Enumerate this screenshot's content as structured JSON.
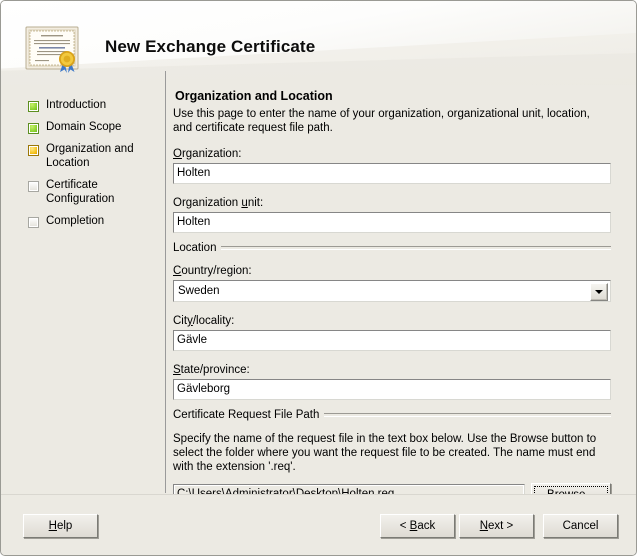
{
  "window": {
    "title": "New Exchange Certificate",
    "icon": "certificate-icon"
  },
  "sidebar": {
    "items": [
      {
        "label": "Introduction",
        "state": "done",
        "icon": "step-complete-icon"
      },
      {
        "label": "Domain Scope",
        "state": "done",
        "icon": "step-complete-icon"
      },
      {
        "label": "Organization and Location",
        "state": "current",
        "icon": "step-current-icon"
      },
      {
        "label": "Certificate Configuration",
        "state": "pending",
        "icon": "step-pending-icon"
      },
      {
        "label": "Completion",
        "state": "pending",
        "icon": "step-pending-icon"
      }
    ]
  },
  "main": {
    "title": "Organization and Location",
    "description": "Use this page to enter the name of your organization, organizational unit, location, and certificate request file path.",
    "fields": {
      "organization": {
        "label_pre": "",
        "label_accel": "O",
        "label_post": "rganization:",
        "value": "Holten"
      },
      "organization_unit": {
        "label_pre": "Organization ",
        "label_accel": "u",
        "label_post": "nit:",
        "value": "Holten"
      },
      "country": {
        "label_pre": "",
        "label_accel": "C",
        "label_post": "ountry/region:",
        "value": "Sweden",
        "icon": "chevron-down-icon"
      },
      "city": {
        "label_pre": "Cit",
        "label_accel": "y",
        "label_post": "/locality:",
        "value": "Gävle"
      },
      "state": {
        "label_pre": "",
        "label_accel": "S",
        "label_post": "tate/province:",
        "value": "Gävleborg"
      },
      "file_path": {
        "value": "C:\\Users\\Administrator\\Desktop\\Holten.req"
      }
    },
    "groups": {
      "location": "Location",
      "certificate_request_file_path": "Certificate Request File Path"
    },
    "file_path_help": "Specify the name of the request file in the text box below. Use the Browse button to select the folder where you want the request file to be created. The name must end with the extension '.req'.",
    "browse_button": {
      "pre": "",
      "accel": "B",
      "post": "rowse..."
    }
  },
  "footer": {
    "help": {
      "pre": "",
      "accel": "H",
      "post": "elp"
    },
    "back": {
      "pre": "< ",
      "accel": "B",
      "post": "ack"
    },
    "next": {
      "pre": "",
      "accel": "N",
      "post": "ext >"
    },
    "cancel": {
      "pre": "Cancel",
      "accel": "",
      "post": ""
    }
  },
  "colors": {
    "dialog_background": "#eceae3",
    "step_done": "#8dd431",
    "step_current": "#f5c21b",
    "accent_text": "#000000"
  }
}
